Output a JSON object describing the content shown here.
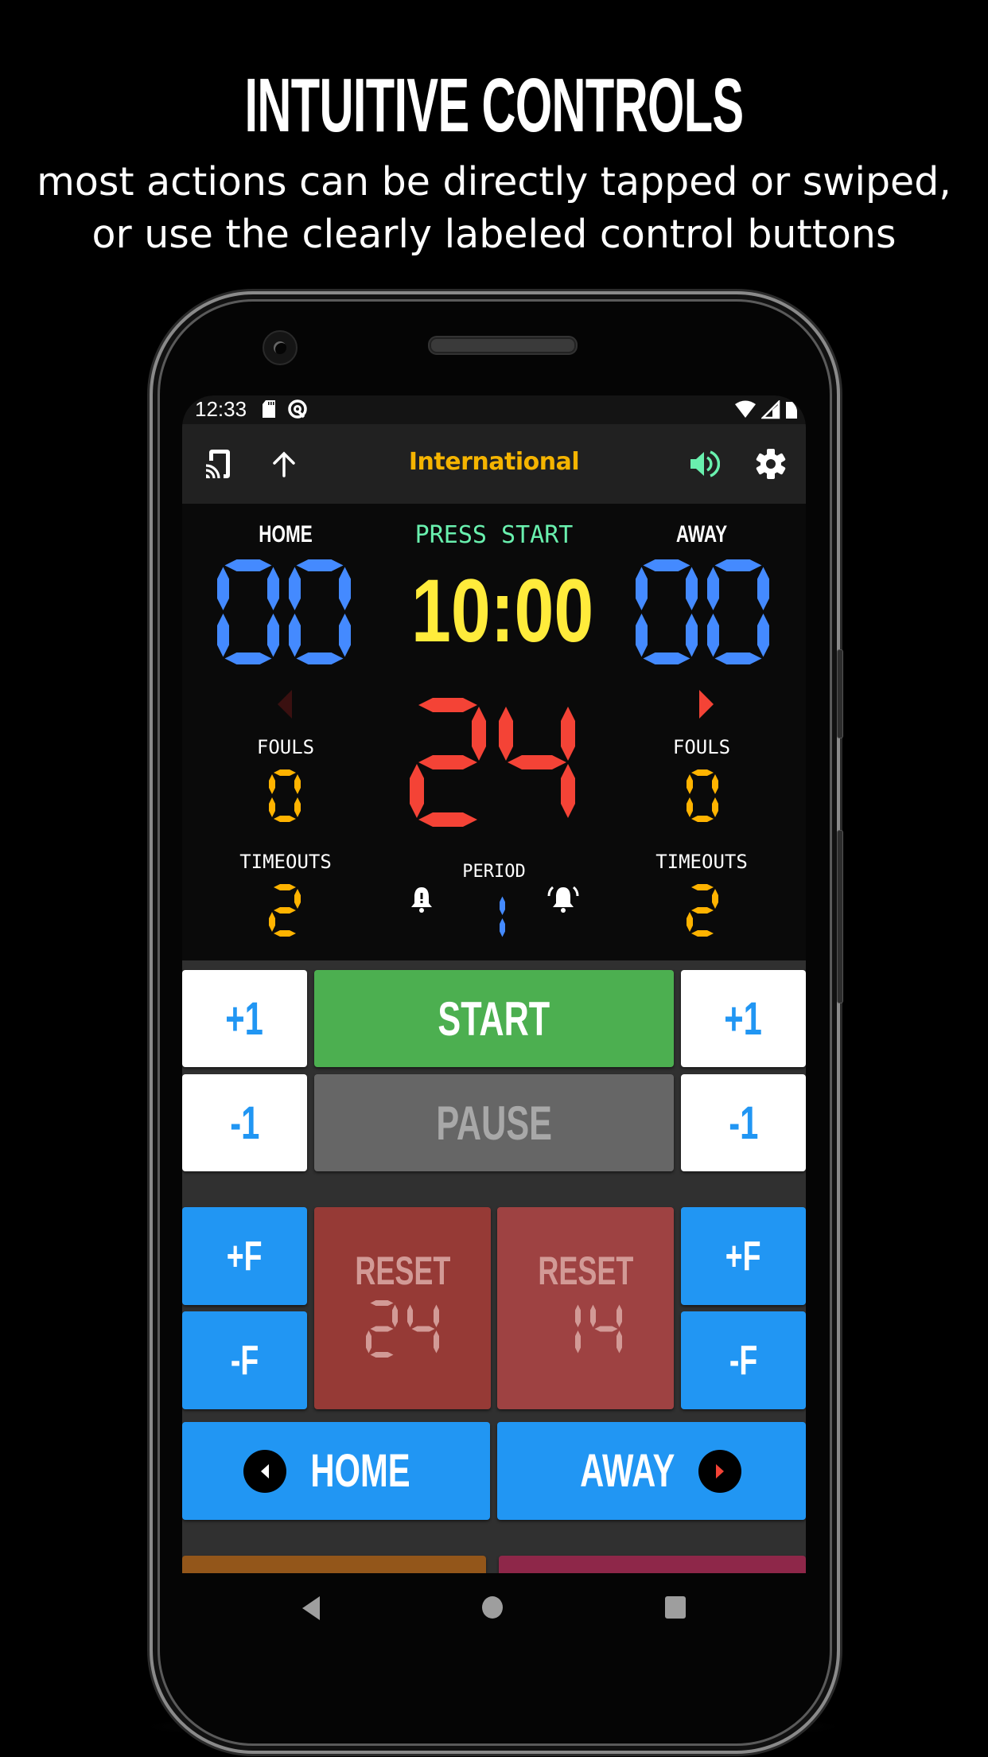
{
  "promo": {
    "headline": "INTUITIVE CONTROLS",
    "subline_1": "most actions can be directly tapped or swiped,",
    "subline_2": "or use the clearly labeled control buttons"
  },
  "status_bar": {
    "time": "12:33",
    "left_icons": [
      "sd-card-icon",
      "at-sign-icon"
    ],
    "right_icons": [
      "wifi-icon",
      "signal-icon",
      "battery-icon"
    ]
  },
  "app_bar": {
    "title": "International",
    "left_icons": [
      "cast-icon",
      "arrow-up-icon"
    ],
    "right_icons": [
      "volume-icon",
      "settings-icon"
    ],
    "colors": {
      "title": "#f5b400",
      "volume": "#69f0ae"
    }
  },
  "scoreboard": {
    "status_text": "PRESS START",
    "game_clock": "10:00",
    "shot_clock": "24",
    "home": {
      "label": "HOME",
      "score": "00",
      "fouls_label": "FOULS",
      "fouls": "0",
      "timeouts_label": "TIMEOUTS",
      "timeouts": "2"
    },
    "away": {
      "label": "AWAY",
      "score": "00",
      "fouls_label": "FOULS",
      "fouls": "0",
      "timeouts_label": "TIMEOUTS",
      "timeouts": "2"
    },
    "period_label": "PERIOD",
    "period": "1",
    "possession": "away",
    "colors": {
      "score": "#448aff",
      "clock": "#ffeb3b",
      "shot_clock": "#f44336",
      "fouls": "#ffb300",
      "period": "#448aff",
      "status": "#69f0ae"
    }
  },
  "controls": {
    "home_plus": "+1",
    "home_minus": "-1",
    "away_plus": "+1",
    "away_minus": "-1",
    "start": "START",
    "pause": "PAUSE",
    "home_foul_plus": "+F",
    "home_foul_minus": "-F",
    "away_foul_plus": "+F",
    "away_foul_minus": "-F",
    "reset_24_label": "RESET",
    "reset_24_value": "24",
    "reset_14_label": "RESET",
    "reset_14_value": "14",
    "possession_home": "HOME",
    "possession_away": "AWAY"
  },
  "nav_bar": {
    "buttons": [
      "back",
      "home",
      "recents"
    ]
  }
}
